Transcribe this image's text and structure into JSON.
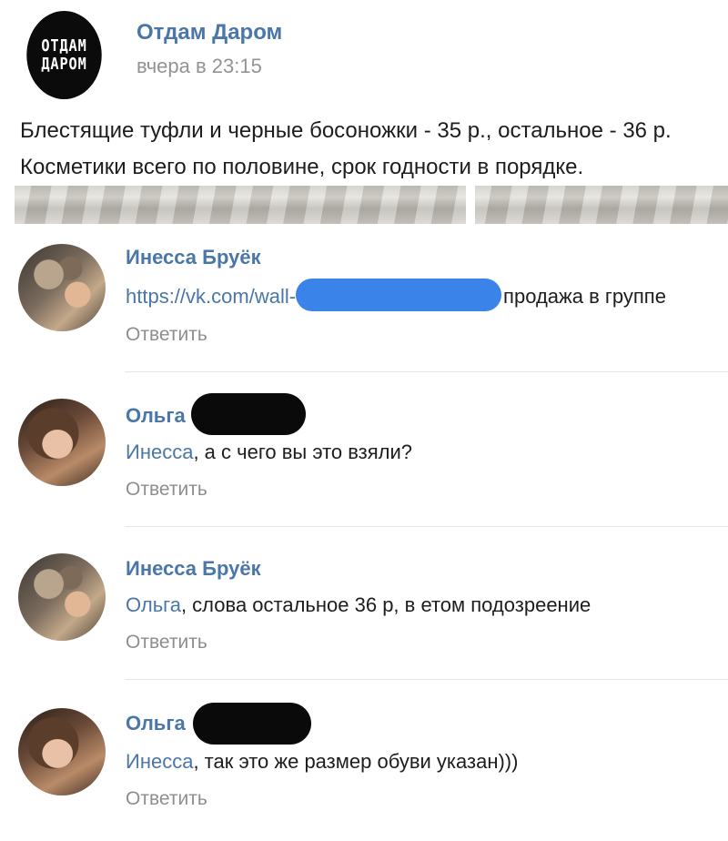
{
  "post": {
    "group_name": "Отдам Даром",
    "avatar_text_line1": "ОТДАМ",
    "avatar_text_line2": "ДАРОМ",
    "time": "вчера в 23:15",
    "text_line1": "Блестящие туфли и черные босоножки - 35 р., остальное - 36 р.",
    "text_line2": "Косметики всего по половине, срок годности в порядке."
  },
  "comments": [
    {
      "author": "Инесса Бруёк",
      "text_before": "https://vk.com/wall-",
      "text_after": "продажа в группе",
      "reply": "Ответить"
    },
    {
      "author": "Ольга",
      "mention": "Инесса",
      "text": ", а с чего вы это взяли?",
      "reply": "Ответить"
    },
    {
      "author": "Инесса Бруёк",
      "mention": "Ольга",
      "text": ", слова остальное 36 р, в етом подозреение",
      "reply": "Ответить"
    },
    {
      "author": "Ольга",
      "mention": "Инесса",
      "text": ", так это же размер обуви указан)))",
      "reply": "Ответить"
    }
  ],
  "colors": {
    "link": "#4a76a8",
    "muted": "#939393",
    "redaction_blue": "#3a83e8",
    "redaction_black": "#0a0a0a"
  }
}
